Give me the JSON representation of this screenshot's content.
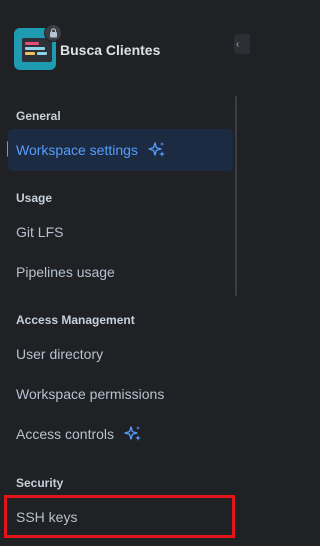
{
  "workspace": {
    "name": "Busca Clientes"
  },
  "sections": {
    "general": "General",
    "usage": "Usage",
    "access": "Access Management",
    "security": "Security"
  },
  "items": {
    "workspace_settings": "Workspace settings",
    "git_lfs": "Git LFS",
    "pipelines_usage": "Pipelines usage",
    "user_directory": "User directory",
    "workspace_permissions": "Workspace permissions",
    "access_controls": "Access controls",
    "ssh_keys": "SSH keys"
  },
  "colors": {
    "background": "#1f2124",
    "active_text": "#579dff",
    "active_bg": "#1c2b41",
    "highlight_border": "#e3151b"
  },
  "icons": [
    "workspace-logo-icon",
    "lock-icon",
    "sparkle-icon",
    "collapse-chevron-icon"
  ]
}
